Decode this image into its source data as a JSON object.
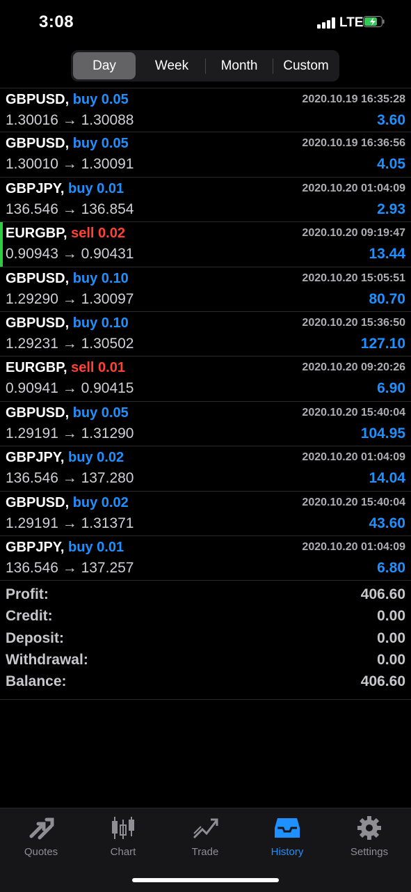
{
  "status": {
    "time": "3:08",
    "network": "LTE"
  },
  "segments": [
    "Day",
    "Week",
    "Month",
    "Custom"
  ],
  "trades": [
    {
      "symbol": "GBPUSD,",
      "side": "buy",
      "side_label": "buy 0.05",
      "time": "2020.10.19 16:35:28",
      "prices": "1.30016 → 1.30088",
      "profit": "3.60",
      "highlight": false
    },
    {
      "symbol": "GBPUSD,",
      "side": "buy",
      "side_label": "buy 0.05",
      "time": "2020.10.19 16:36:56",
      "prices": "1.30010 → 1.30091",
      "profit": "4.05",
      "highlight": false
    },
    {
      "symbol": "GBPJPY,",
      "side": "buy",
      "side_label": "buy 0.01",
      "time": "2020.10.20 01:04:09",
      "prices": "136.546 → 136.854",
      "profit": "2.93",
      "highlight": false
    },
    {
      "symbol": "EURGBP,",
      "side": "sell",
      "side_label": "sell 0.02",
      "time": "2020.10.20 09:19:47",
      "prices": "0.90943 → 0.90431",
      "profit": "13.44",
      "highlight": true
    },
    {
      "symbol": "GBPUSD,",
      "side": "buy",
      "side_label": "buy 0.10",
      "time": "2020.10.20 15:05:51",
      "prices": "1.29290 → 1.30097",
      "profit": "80.70",
      "highlight": false
    },
    {
      "symbol": "GBPUSD,",
      "side": "buy",
      "side_label": "buy 0.10",
      "time": "2020.10.20 15:36:50",
      "prices": "1.29231 → 1.30502",
      "profit": "127.10",
      "highlight": false
    },
    {
      "symbol": "EURGBP,",
      "side": "sell",
      "side_label": "sell 0.01",
      "time": "2020.10.20 09:20:26",
      "prices": "0.90941 → 0.90415",
      "profit": "6.90",
      "highlight": false
    },
    {
      "symbol": "GBPUSD,",
      "side": "buy",
      "side_label": "buy 0.05",
      "time": "2020.10.20 15:40:04",
      "prices": "1.29191 → 1.31290",
      "profit": "104.95",
      "highlight": false
    },
    {
      "symbol": "GBPJPY,",
      "side": "buy",
      "side_label": "buy 0.02",
      "time": "2020.10.20 01:04:09",
      "prices": "136.546 → 137.280",
      "profit": "14.04",
      "highlight": false
    },
    {
      "symbol": "GBPUSD,",
      "side": "buy",
      "side_label": "buy 0.02",
      "time": "2020.10.20 15:40:04",
      "prices": "1.29191 → 1.31371",
      "profit": "43.60",
      "highlight": false
    },
    {
      "symbol": "GBPJPY,",
      "side": "buy",
      "side_label": "buy 0.01",
      "time": "2020.10.20 01:04:09",
      "prices": "136.546 → 137.257",
      "profit": "6.80",
      "highlight": false
    }
  ],
  "summary": [
    {
      "label": "Profit:",
      "value": "406.60"
    },
    {
      "label": "Credit:",
      "value": "0.00"
    },
    {
      "label": "Deposit:",
      "value": "0.00"
    },
    {
      "label": "Withdrawal:",
      "value": "0.00"
    },
    {
      "label": "Balance:",
      "value": "406.60"
    }
  ],
  "tabs": [
    {
      "label": "Quotes",
      "icon": "quotes-arrows-icon"
    },
    {
      "label": "Chart",
      "icon": "candlestick-chart-icon"
    },
    {
      "label": "Trade",
      "icon": "trade-trend-icon"
    },
    {
      "label": "History",
      "icon": "history-tray-icon",
      "active": true
    },
    {
      "label": "Settings",
      "icon": "gear-icon"
    }
  ],
  "colors": {
    "accent": "#1e90ff",
    "sell": "#ff4136",
    "highlight": "#2ecc40",
    "battery_charging": "#34c759"
  }
}
